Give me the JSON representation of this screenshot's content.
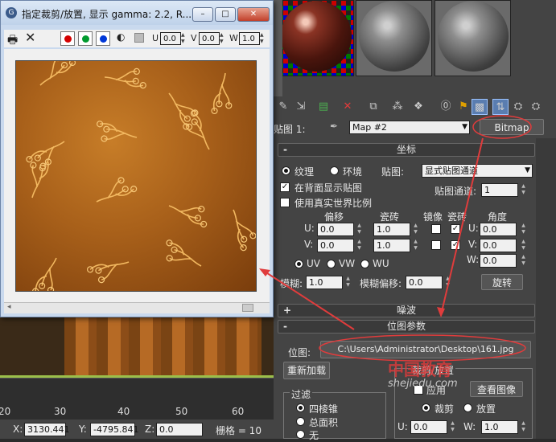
{
  "bitmap_window": {
    "title": "指定裁剪/放置, 显示 gamma: 2.2, R...",
    "minimize": "–",
    "maximize": "□",
    "close": "✕",
    "u_label": "U",
    "u_value": "0.0",
    "v_label": "V",
    "v_value": "0.0",
    "w_label": "W",
    "w_value": "1.0",
    "channel_colors": [
      "#d40000",
      "#009a2e",
      "#0038d8"
    ]
  },
  "toolbar_icons": [
    "slot-icon",
    "put-to-scene-icon",
    "assign-icon",
    "reset-icon",
    "copy-icon",
    "unique-icon",
    "put-library-icon",
    "material-id-icon",
    "show-map-icon",
    "show-end-icon",
    "go-parent-icon",
    "go-sibling-icon"
  ],
  "map_row": {
    "label": "贴图 1:",
    "dropdown": "Map #2",
    "type_button": "Bitmap"
  },
  "coords": {
    "header": "坐标",
    "radio_texture": "纹理",
    "radio_env": "环境",
    "mapping_label": "贴图:",
    "mapping_value": "显式贴图通道",
    "show_back": "在背面显示贴图",
    "real_world": "使用真实世界比例",
    "channel_label": "贴图通道:",
    "channel_value": "1",
    "col_offset": "偏移",
    "col_tiling": "瓷砖",
    "col_mirror": "镜像",
    "col_tile": "瓷砖",
    "col_angle": "角度",
    "u_label": "U:",
    "v_label": "V:",
    "w_label": "W:",
    "u_offset": "0.0",
    "v_offset": "0.0",
    "u_tiling": "1.0",
    "v_tiling": "1.0",
    "u_angle": "0.0",
    "v_angle": "0.0",
    "w_angle": "0.0",
    "uv": "UV",
    "vw": "VW",
    "wu": "WU",
    "blur_label": "模糊:",
    "blur_value": "1.0",
    "blur_offset_label": "模糊偏移:",
    "blur_offset_value": "0.0",
    "rotate_button": "旋转"
  },
  "noise": {
    "header": "噪波",
    "sign": "+"
  },
  "bitmap_params": {
    "header": "位图参数",
    "sign": "-",
    "bitmap_label": "位图:",
    "bitmap_path": "C:\\Users\\Administrator\\Desktop\\161.jpg",
    "reload": "重新加载",
    "crop_header": "裁剪/放置",
    "apply": "应用",
    "view_image": "查看图像",
    "crop": "裁剪",
    "place": "放置",
    "filter_header": "过滤",
    "pyramid": "四棱锥",
    "summed": "总面积",
    "none": "无",
    "u_label": "U:",
    "u_value": "0.0",
    "w_label": "W:",
    "w_value": "1.0"
  },
  "timeline": {
    "ticks": [
      "20",
      "30",
      "40",
      "50",
      "60"
    ]
  },
  "status": {
    "x_label": "X:",
    "x_value": "3130.441",
    "y_label": "Y:",
    "y_value": "-4795.841",
    "z_label": "Z:",
    "z_value": "0.0",
    "grid_label": "栅格 = 10"
  },
  "watermark": "中国教育",
  "watermark_site": "shejiedu.com"
}
